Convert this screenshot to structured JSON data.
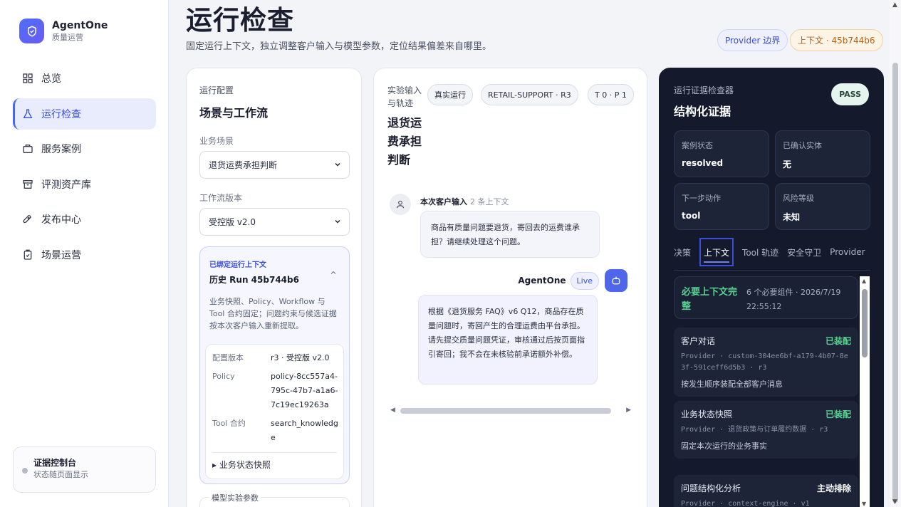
{
  "brand": {
    "name": "AgentOne",
    "sub": "质量运营",
    "icon": "shield-check-icon"
  },
  "nav": [
    {
      "label": "总览",
      "icon": "grid-icon"
    },
    {
      "label": "运行检查",
      "icon": "flask-icon",
      "active": true
    },
    {
      "label": "服务案例",
      "icon": "briefcase-icon"
    },
    {
      "label": "评测资产库",
      "icon": "archive-icon"
    },
    {
      "label": "发布中心",
      "icon": "rocket-icon"
    },
    {
      "label": "场景运营",
      "icon": "clipboard-icon"
    }
  ],
  "evidence_console": {
    "title": "证据控制台",
    "sub": "状态随页面显示"
  },
  "header": {
    "title": "运行检查",
    "desc": "固定运行上下文，独立调整客户输入与模型参数，定位结果偏差来自哪里。",
    "chip_provider": "Provider 边界",
    "chip_context": "上下文 · 45b744b6"
  },
  "config": {
    "label": "运行配置",
    "title": "场景与工作流",
    "scene_label": "业务场景",
    "scene_value": "退货运费承担判断",
    "workflow_label": "工作流版本",
    "workflow_value": "受控版 v2.0",
    "bound": {
      "label": "已绑定运行上下文",
      "title": "历史 Run 45b744b6",
      "desc": "业务快照、Policy、Workflow 与 Tool 合约固定；问题约束与候选证据按本次客户输入重新提取。",
      "rows": [
        {
          "k": "配置版本",
          "v": "r3 · 受控版 v2.0"
        },
        {
          "k": "Policy",
          "v": "policy-8cc557a4-795c-47b7-a1a6-7c19ec19263a"
        },
        {
          "k": "Tool 合约",
          "v": "search_knowledge"
        }
      ],
      "detail": "▸ 业务状态快照"
    },
    "model_params": "模型实验参数"
  },
  "experiment": {
    "label": "实验输入与轨迹",
    "title": "退货运费承担判断",
    "pills": [
      "真实运行",
      "RETAIL-SUPPORT · R3",
      "T 0 · P 1"
    ],
    "user_head": "本次客户输入",
    "user_meta": "2 条上下文",
    "user_msg": "商品有质量问题要退货，寄回去的运费谁承担？请继续处理这个问题。",
    "agent_name": "AgentOne",
    "agent_tag": "Live",
    "agent_msg": "根据《退货服务 FAQ》v6 Q12，商品存在质量问题时，寄回产生的合理运费由平台承担。请先提交质量问题凭证，审核通过后按页面指引寄回；我不会在未核验前承诺额外补偿。"
  },
  "inspector": {
    "label": "运行证据检查器",
    "title": "结构化证据",
    "badge": "PASS",
    "stats": [
      {
        "k": "案例状态",
        "v": "resolved"
      },
      {
        "k": "已确认实体",
        "v": "无"
      },
      {
        "k": "下一步动作",
        "v": "tool"
      },
      {
        "k": "风险等级",
        "v": "未知"
      }
    ],
    "tabs": [
      "决策",
      "上下文",
      "Tool 轨迹",
      "安全守卫",
      "Provider"
    ],
    "active_tab": 1,
    "complete": {
      "title": "必要上下文完整",
      "meta": "6 个必要组件 · 2026/7/19 22:55:12"
    },
    "items": [
      {
        "title": "客户对话",
        "status": "已装配",
        "mono": "Provider · custom-304ee6bf-a179-4b07-8e3f-591ceff6d5b3 · r3",
        "desc": "按发生顺序装配全部客户消息"
      },
      {
        "title": "业务状态快照",
        "status": "已装配",
        "mono": "Provider · 退货政策与订单履约数据 · r3",
        "desc": "固定本次运行的业务事实"
      },
      {
        "title": "问题结构化分析",
        "status": "主动排除",
        "mono": "Provider · context-engine · v1",
        "desc": ""
      }
    ]
  }
}
